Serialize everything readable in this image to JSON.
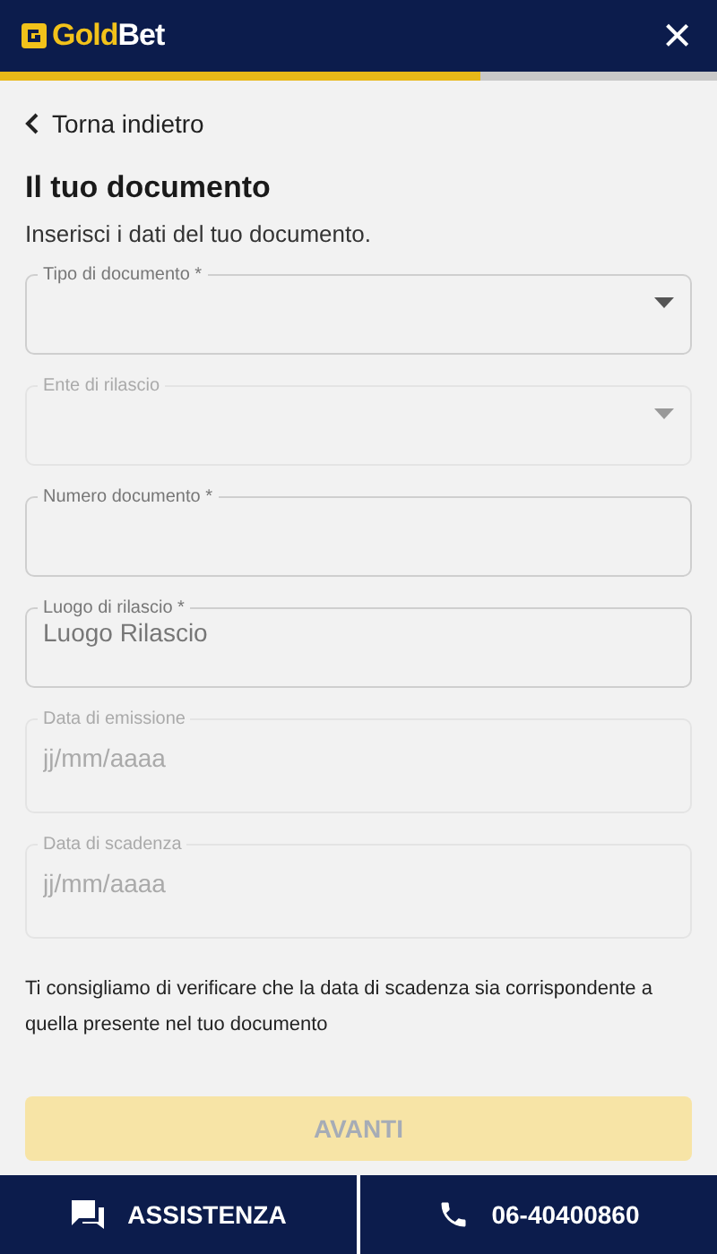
{
  "header": {
    "logo": {
      "first": "Gold",
      "second": "Bet"
    },
    "close": "×"
  },
  "progress": {
    "level": 0.67
  },
  "back_link": "Torna indietro",
  "title": "Il tuo documento",
  "subtitle": "Inserisci i dati del tuo documento.",
  "fields": [
    {
      "kind": "select",
      "label": "Tipo di documento *",
      "disabled": false
    },
    {
      "kind": "select",
      "label": "Ente di rilascio",
      "disabled": true
    },
    {
      "kind": "text",
      "label": "Numero documento *",
      "disabled": false
    },
    {
      "kind": "text",
      "label": "Luogo di rilascio *",
      "placeholder": "Luogo Rilascio",
      "disabled": false
    },
    {
      "kind": "date",
      "label": "Data di emissione",
      "placeholder": "jj/mm/aaaa",
      "disabled": true
    },
    {
      "kind": "date",
      "label": "Data di scadenza",
      "placeholder": "jj/mm/aaaa",
      "disabled": true
    }
  ],
  "note": "Ti consigliamo di verificare che la data di scadenza sia corrispondente a quella presente nel tuo documento",
  "next_button": {
    "label": "AVANTI",
    "disabled": true
  },
  "footer": [
    {
      "kind": "chat",
      "label": "ASSISTENZA"
    },
    {
      "kind": "phone",
      "label": "06-40400860"
    }
  ]
}
